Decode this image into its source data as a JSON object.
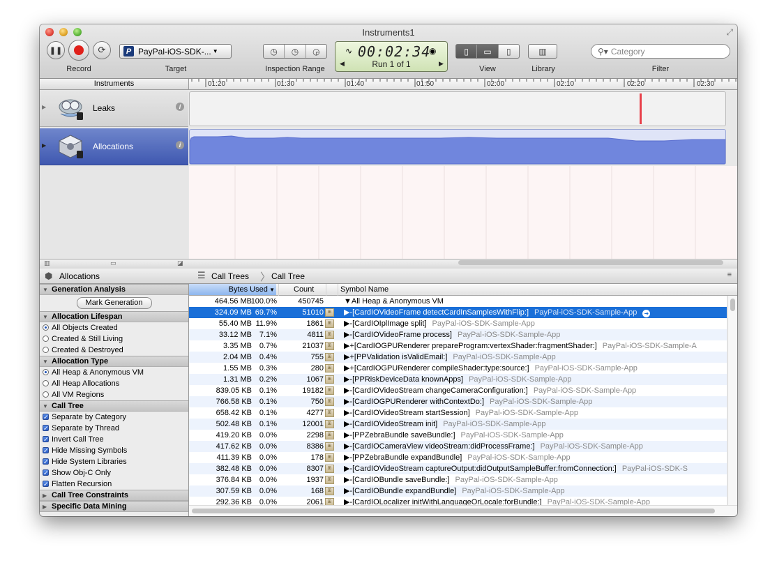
{
  "window": {
    "title": "Instruments1"
  },
  "toolbar": {
    "record_label": "Record",
    "target_label": "Target",
    "target_value": "PayPal-iOS-SDK-...",
    "inspection_label": "Inspection Range",
    "timer": "00:02:34",
    "run": "Run 1 of 1",
    "view_label": "View",
    "library_label": "Library",
    "filter_label": "Filter",
    "filter_placeholder": "Category"
  },
  "ruler": {
    "header": "Instruments",
    "ticks": [
      "01:20",
      "01:30",
      "01:40",
      "01:50",
      "02:00",
      "02:10",
      "02:20",
      "02:30"
    ]
  },
  "instruments": [
    {
      "name": "Leaks"
    },
    {
      "name": "Allocations"
    }
  ],
  "detail": {
    "title": "Allocations",
    "crumbs": [
      "Call Trees",
      "Call Tree"
    ]
  },
  "sidebar": {
    "generation": {
      "title": "Generation Analysis",
      "button": "Mark Generation"
    },
    "lifespan": {
      "title": "Allocation Lifespan",
      "options": [
        "All Objects Created",
        "Created & Still Living",
        "Created & Destroyed"
      ],
      "selected": 0
    },
    "type": {
      "title": "Allocation Type",
      "options": [
        "All Heap & Anonymous VM",
        "All Heap Allocations",
        "All VM Regions"
      ],
      "selected": 0
    },
    "calltree": {
      "title": "Call Tree",
      "options": [
        "Separate by Category",
        "Separate by Thread",
        "Invert Call Tree",
        "Hide Missing Symbols",
        "Hide System Libraries",
        "Show Obj-C Only",
        "Flatten Recursion"
      ]
    },
    "constraints": {
      "title": "Call Tree Constraints"
    },
    "mining": {
      "title": "Specific Data Mining"
    }
  },
  "table": {
    "columns": {
      "bytes": "Bytes Used",
      "count": "Count",
      "symbol": "Symbol Name"
    },
    "rows": [
      {
        "bytes": "464.56 MB",
        "pct": "100.0%",
        "count": "450745",
        "symbol": "▼All Heap & Anonymous VM",
        "lib": ""
      },
      {
        "bytes": "324.09 MB",
        "pct": "69.7%",
        "count": "51010",
        "symbol": "▶-[CardIOVideoFrame detectCardInSamplesWithFlip:]",
        "lib": "PayPal-iOS-SDK-Sample-App"
      },
      {
        "bytes": "55.40 MB",
        "pct": "11.9%",
        "count": "1861",
        "symbol": "▶-[CardIOIplImage split]",
        "lib": "PayPal-iOS-SDK-Sample-App"
      },
      {
        "bytes": "33.12 MB",
        "pct": "7.1%",
        "count": "4811",
        "symbol": "▶-[CardIOVideoFrame process]",
        "lib": "PayPal-iOS-SDK-Sample-App"
      },
      {
        "bytes": "3.35 MB",
        "pct": "0.7%",
        "count": "21037",
        "symbol": "▶+[CardIOGPURenderer prepareProgram:vertexShader:fragmentShader:]",
        "lib": "PayPal-iOS-SDK-Sample-A"
      },
      {
        "bytes": "2.04 MB",
        "pct": "0.4%",
        "count": "755",
        "symbol": "▶+[PPValidation isValidEmail:]",
        "lib": "PayPal-iOS-SDK-Sample-App"
      },
      {
        "bytes": "1.55 MB",
        "pct": "0.3%",
        "count": "280",
        "symbol": "▶+[CardIOGPURenderer compileShader:type:source:]",
        "lib": "PayPal-iOS-SDK-Sample-App"
      },
      {
        "bytes": "1.31 MB",
        "pct": "0.2%",
        "count": "1067",
        "symbol": "▶-[PPRiskDeviceData knownApps]",
        "lib": "PayPal-iOS-SDK-Sample-App"
      },
      {
        "bytes": "839.05 KB",
        "pct": "0.1%",
        "count": "19182",
        "symbol": "▶-[CardIOVideoStream changeCameraConfiguration:]",
        "lib": "PayPal-iOS-SDK-Sample-App"
      },
      {
        "bytes": "766.58 KB",
        "pct": "0.1%",
        "count": "750",
        "symbol": "▶-[CardIOGPURenderer withContextDo:]",
        "lib": "PayPal-iOS-SDK-Sample-App"
      },
      {
        "bytes": "658.42 KB",
        "pct": "0.1%",
        "count": "4277",
        "symbol": "▶-[CardIOVideoStream startSession]",
        "lib": "PayPal-iOS-SDK-Sample-App"
      },
      {
        "bytes": "502.48 KB",
        "pct": "0.1%",
        "count": "12001",
        "symbol": "▶-[CardIOVideoStream init]",
        "lib": "PayPal-iOS-SDK-Sample-App"
      },
      {
        "bytes": "419.20 KB",
        "pct": "0.0%",
        "count": "2298",
        "symbol": "▶-[PPZebraBundle saveBundle:]",
        "lib": "PayPal-iOS-SDK-Sample-App"
      },
      {
        "bytes": "417.62 KB",
        "pct": "0.0%",
        "count": "8386",
        "symbol": "▶-[CardIOCameraView videoStream:didProcessFrame:]",
        "lib": "PayPal-iOS-SDK-Sample-App"
      },
      {
        "bytes": "411.39 KB",
        "pct": "0.0%",
        "count": "178",
        "symbol": "▶-[PPZebraBundle expandBundle]",
        "lib": "PayPal-iOS-SDK-Sample-App"
      },
      {
        "bytes": "382.48 KB",
        "pct": "0.0%",
        "count": "8307",
        "symbol": "▶-[CardIOVideoStream captureOutput:didOutputSampleBuffer:fromConnection:]",
        "lib": "PayPal-iOS-SDK-S"
      },
      {
        "bytes": "376.84 KB",
        "pct": "0.0%",
        "count": "1937",
        "symbol": "▶-[CardIOBundle saveBundle:]",
        "lib": "PayPal-iOS-SDK-Sample-App"
      },
      {
        "bytes": "307.59 KB",
        "pct": "0.0%",
        "count": "168",
        "symbol": "▶-[CardIOBundle expandBundle]",
        "lib": "PayPal-iOS-SDK-Sample-App"
      },
      {
        "bytes": "292.36 KB",
        "pct": "0.0%",
        "count": "2061",
        "symbol": "▶-[CardIOLocalizer initWithLanguageOrLocale:forBundle:]",
        "lib": "PayPal-iOS-SDK-Sample-App"
      }
    ],
    "selected_row": 1
  }
}
